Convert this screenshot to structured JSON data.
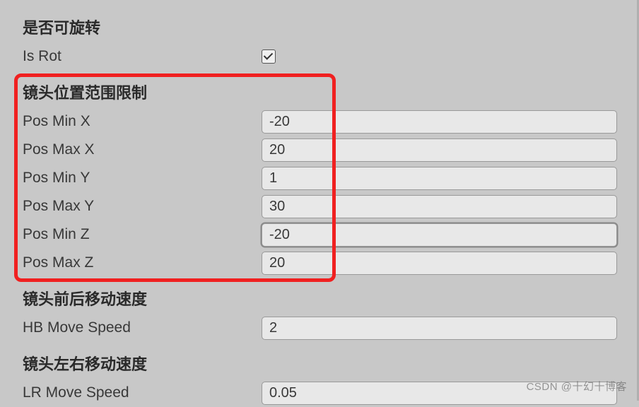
{
  "groups": {
    "rotation": {
      "header": "是否可旋转",
      "is_rot": {
        "label": "Is Rot",
        "checked": true
      }
    },
    "position_limit": {
      "header": "镜头位置范围限制",
      "pos_min_x": {
        "label": "Pos Min X",
        "value": "-20"
      },
      "pos_max_x": {
        "label": "Pos Max X",
        "value": "20"
      },
      "pos_min_y": {
        "label": "Pos Min Y",
        "value": "1"
      },
      "pos_max_y": {
        "label": "Pos Max Y",
        "value": "30"
      },
      "pos_min_z": {
        "label": "Pos Min Z",
        "value": "-20"
      },
      "pos_max_z": {
        "label": "Pos Max Z",
        "value": "20"
      }
    },
    "hb_speed": {
      "header": "镜头前后移动速度",
      "hb_move_speed": {
        "label": "HB Move Speed",
        "value": "2"
      }
    },
    "lr_speed": {
      "header": "镜头左右移动速度",
      "lr_move_speed": {
        "label": "LR Move Speed",
        "value": "0.05"
      }
    }
  },
  "watermark": "CSDN @十幻十博客"
}
